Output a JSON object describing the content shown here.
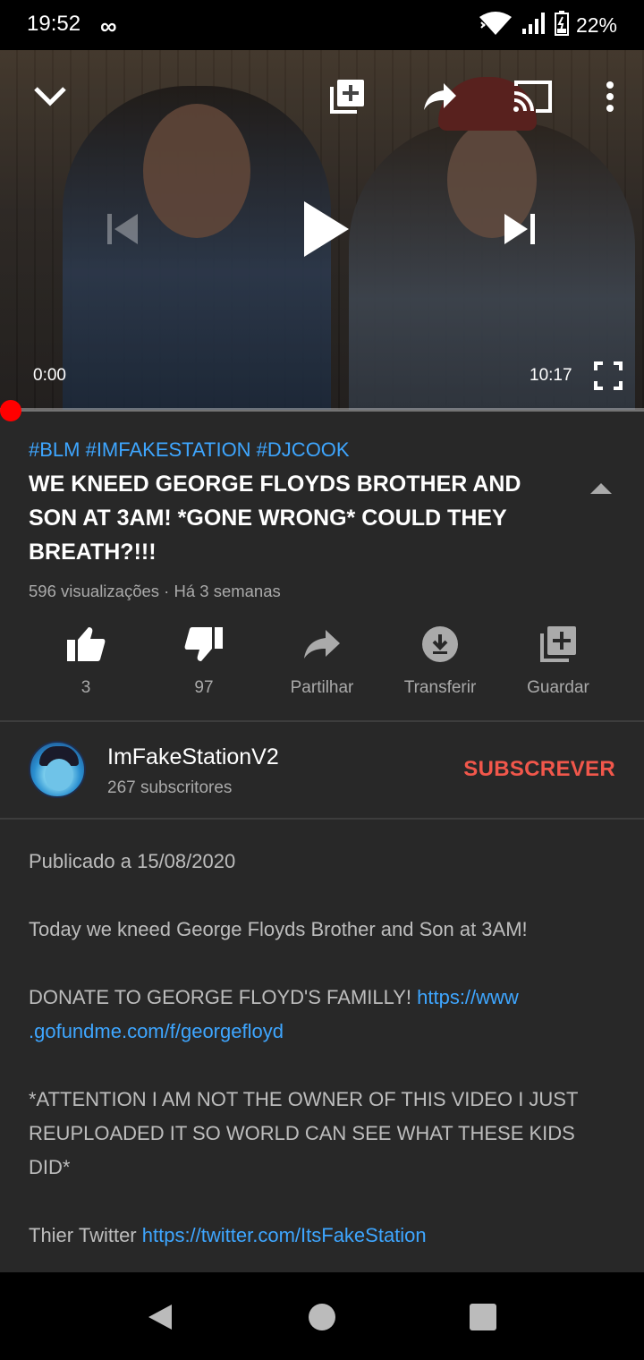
{
  "status_bar": {
    "time": "19:52",
    "infinity_glyph": "∞",
    "battery_percent": "22%",
    "icons": [
      "wifi-icon",
      "signal-icon",
      "battery-icon"
    ]
  },
  "player": {
    "current_time": "0:00",
    "duration": "10:17",
    "progress_fraction": 0.0,
    "controls": [
      "collapse-chevron-icon",
      "add-to-queue-icon",
      "share-arrow-icon",
      "cast-icon",
      "more-vert-icon",
      "previous-icon",
      "play-icon",
      "next-icon",
      "fullscreen-icon"
    ]
  },
  "video": {
    "hashtags": "#BLM #IMFAKESTATION #DJCOOK",
    "title": "WE KNEED GEORGE FLOYDS BROTHER AND SON AT 3AM! *GONE WRONG* COULD THEY BREATH?!!!",
    "meta": "596 visualizações · Há 3 semanas"
  },
  "actions": {
    "like": "3",
    "dislike": "97",
    "share": "Partilhar",
    "download": "Transferir",
    "save": "Guardar"
  },
  "channel": {
    "name": "ImFakeStationV2",
    "subscribers": "267 subscritores",
    "subscribe_label": "SUBSCREVER"
  },
  "description": {
    "published": "Publicado a 15/08/2020",
    "line1": "Today we kneed George Floyds Brother and Son at 3AM!",
    "donate_text": "DONATE TO GEORGE FLOYD'S FAMILLY! ",
    "donate_link_1": "https://www",
    "donate_link_2": ".gofundme.com/f/georgefloyd",
    "attention": "*ATTENTION I AM NOT THE OWNER OF THIS VIDEO I JUST REUPLOADED IT SO WORLD CAN SEE WHAT THESE KIDS DID*",
    "twitter_text": "Thier Twitter ",
    "twitter_link": "https://twitter.com/ItsFakeStation"
  },
  "colors": {
    "accent_red": "#f1574b",
    "link_blue": "#3ea6ff",
    "background": "#282828"
  }
}
